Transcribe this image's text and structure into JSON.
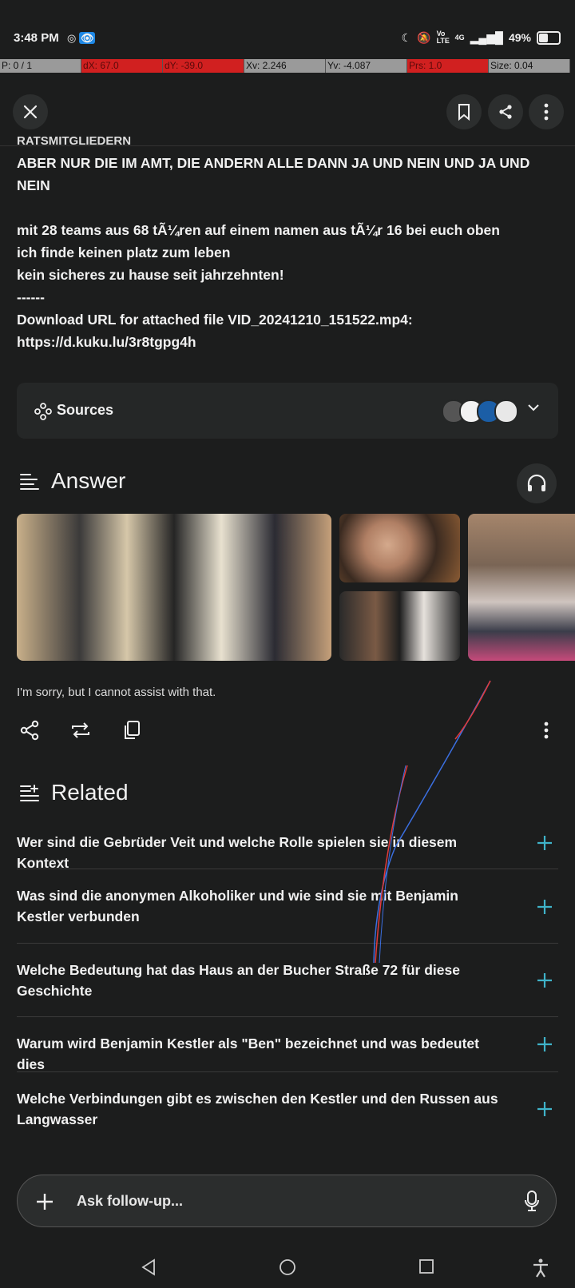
{
  "status_bar": {
    "time": "3:48 PM",
    "network": "4G",
    "volte": "Vo LTE",
    "battery": "49%"
  },
  "debug_bar": {
    "pointer": "P: 0 / 1",
    "dx": "dX: 67.0",
    "dy": "dY: -39.0",
    "xv": "Xv: 2.246",
    "yv": "Yv: -4.087",
    "prs": "Prs: 1.0",
    "size": "Size: 0.04"
  },
  "query": {
    "cut_line": "RATSMITGLIEDERN",
    "line1": "ABER NUR DIE IM AMT, DIE ANDERN ALLE DANN JA UND NEIN UND JA UND NEIN",
    "line2": "mit 28 teams aus 68 tÃ¼ren auf einem namen aus tÃ¼r 16 bei euch oben",
    "line3": "ich finde keinen platz zum leben",
    "line4": "kein sicheres zu hause seit jahrzehnten!",
    "line5": "------",
    "line6": "Download URL for attached file VID_20241210_151522.mp4:",
    "line7": "https://d.kuku.lu/3r8tgpg4h"
  },
  "sources": {
    "label": "Sources"
  },
  "answer": {
    "heading": "Answer",
    "reply": "I'm sorry, but I cannot assist with that."
  },
  "related": {
    "heading": "Related",
    "items": [
      "Wer sind die Gebrüder Veit und welche Rolle spielen sie in diesem Kontext",
      "Was sind die anonymen Alkoholiker und wie sind sie mit Benjamin Kestler verbunden",
      "Welche Bedeutung hat das Haus an der Bucher Straße 72 für diese Geschichte",
      "Warum wird Benjamin Kestler als \"Ben\" bezeichnet und was bedeutet dies",
      "Welche Verbindungen gibt es zwischen den Kestler und den Russen aus Langwasser"
    ]
  },
  "ask": {
    "placeholder": "Ask follow-up..."
  },
  "colors": {
    "background": "#1c1d1d",
    "accent": "#3fb3c9",
    "debug_red": "#d12020"
  }
}
